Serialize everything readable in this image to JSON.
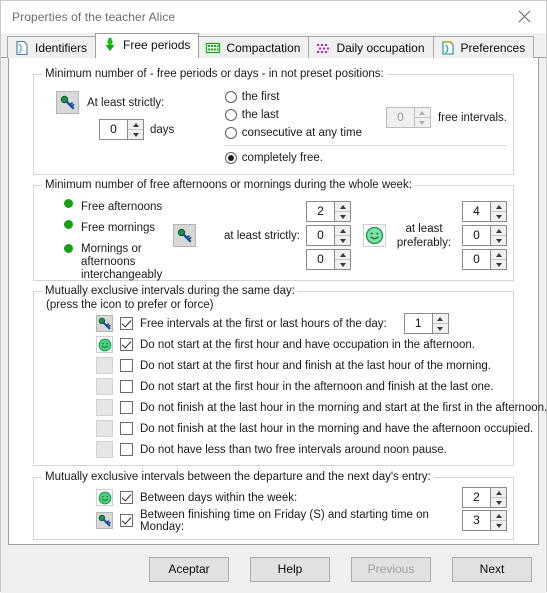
{
  "window": {
    "title": "Properties of the teacher Alice",
    "close_icon": "close-icon"
  },
  "tabs": [
    {
      "label": "Identifiers",
      "icon": "page-icon",
      "active": false
    },
    {
      "label": "Free periods",
      "icon": "green-arrow-down-icon",
      "active": true
    },
    {
      "label": "Compactation",
      "icon": "green-grid-icon",
      "active": false
    },
    {
      "label": "Daily occupation",
      "icon": "magenta-dots-icon",
      "active": false
    },
    {
      "label": "Preferences",
      "icon": "teal-page-icon",
      "active": false
    }
  ],
  "group1": {
    "legend": "Minimum number of - free periods or days - in not preset positions:",
    "key_icon": "key-icon",
    "at_least_strictly_label": "At least strictly:",
    "days_value": "0",
    "days_label": "days",
    "radios": [
      {
        "label": "the first",
        "selected": false
      },
      {
        "label": "the last",
        "selected": false
      },
      {
        "label": "consecutive at any time",
        "selected": false
      },
      {
        "label": "completely free.",
        "selected": true
      }
    ],
    "free_intervals_value": "0",
    "free_intervals_label": "free intervals.",
    "free_intervals_enabled": false
  },
  "group2": {
    "legend": "Minimum number of free afternoons or mornings during the whole week:",
    "bullets": [
      "Free afternoons",
      "Free mornings",
      "Mornings or afternoons interchangeably"
    ],
    "key_icon": "key-icon",
    "strict_label": "at least strictly:",
    "strict_values": [
      "2",
      "0",
      "0"
    ],
    "smiley_icon": "smiley-icon",
    "preferred_label": "at least preferably:",
    "preferred_values": [
      "4",
      "0",
      "0"
    ]
  },
  "group3": {
    "legend": "Mutually exclusive intervals during the same day:",
    "note": "(press the icon to prefer or force)",
    "rows": [
      {
        "icon": "key-icon",
        "checked": true,
        "label": "Free intervals at the first or last hours of the day:",
        "spinner": "1"
      },
      {
        "icon": "smiley-icon",
        "checked": true,
        "label": "Do not start at the first hour and have occupation in the afternoon.",
        "spinner": null
      },
      {
        "icon": "blank-icon",
        "checked": false,
        "label": "Do not start at the first hour and finish at the last hour of the morning.",
        "spinner": null
      },
      {
        "icon": "blank-icon",
        "checked": false,
        "label": "Do not start at the first hour in the afternoon and finish at the last one.",
        "spinner": null
      },
      {
        "icon": "blank-icon",
        "checked": false,
        "label": "Do not finish at the last hour in the morning and start at the first in the afternoon.",
        "spinner": null
      },
      {
        "icon": "blank-icon",
        "checked": false,
        "label": "Do not finish at the last hour in the morning and have the afternoon occupied.",
        "spinner": null
      },
      {
        "icon": "blank-icon",
        "checked": false,
        "label": "Do not have less than two free intervals around noon pause.",
        "spinner": null
      }
    ]
  },
  "group4": {
    "legend": "Mutually exclusive intervals between the departure and the next day's entry:",
    "rows": [
      {
        "icon": "smiley-icon",
        "checked": true,
        "label": "Between days within the week:",
        "spinner": "2"
      },
      {
        "icon": "key-icon",
        "checked": true,
        "label": "Between finishing time on Friday (S) and starting time on Monday:",
        "spinner": "3"
      }
    ]
  },
  "footer": {
    "accept": "Aceptar",
    "help": "Help",
    "previous": "Previous",
    "next": "Next"
  },
  "colors": {
    "green": "#14a014",
    "accent_blue": "#2b5fa8",
    "window_bg": "#f0f0f0"
  }
}
